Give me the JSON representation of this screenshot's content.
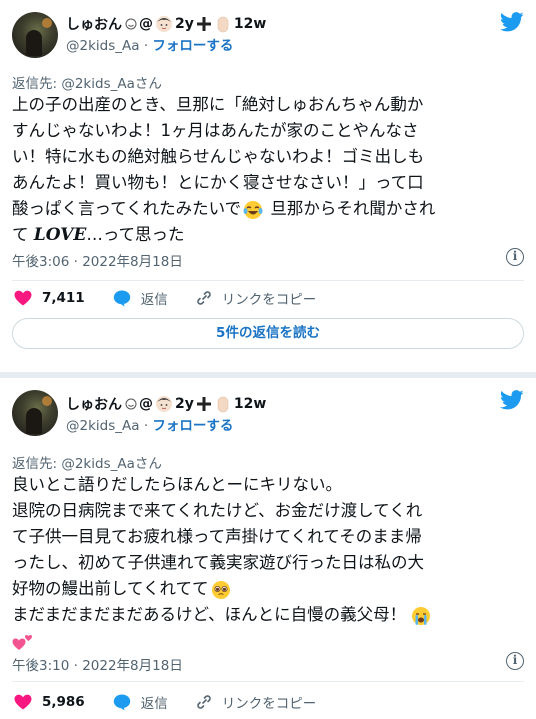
{
  "tweets": [
    {
      "display_name": "しゅおん",
      "name_suffix": "2y",
      "name_suffix2": "12w",
      "handle": "@2kids_Aa",
      "follow_label": "フォローする",
      "reply_to": "返信先: @2kids_Aaさん",
      "lines": [
        "上の子の出産のとき、旦那に「絶対しゅおんちゃん動か",
        "すんじゃないわよ！1ヶ月はあんたが家のことやんなさ",
        "い！特に水もの絶対触らせんじゃないわよ！ゴミ出しも",
        "あんたよ！買い物も！とにかく寝させなさい！」って口",
        "酸っぱく言ってくれたみたいで",
        " 旦那からそれ聞かされ",
        "て ",
        "LOVE",
        "…って思った"
      ],
      "timestamp": "午後3:06 · 2022年8月18日",
      "likes": "7,411",
      "reply_label": "返信",
      "copy_link_label": "リンクをコピー",
      "read_replies_label": "5件の返信を読む"
    },
    {
      "display_name": "しゅおん",
      "name_suffix": "2y",
      "name_suffix2": "12w",
      "handle": "@2kids_Aa",
      "follow_label": "フォローする",
      "reply_to": "返信先: @2kids_Aaさん",
      "lines": [
        "良いとこ語りだしたらほんとーにキリない。",
        "退院の日病院まで来てくれたけど、お金だけ渡してくれ",
        "て子供一目見てお疲れ様って声掛けてくれてそのまま帰",
        "ったし、初めて子供連れて義実家遊び行った日は私の大",
        "好物の鰻出前してくれてて",
        "まだまだまだまだあるけど、ほんとに自慢の義父母！"
      ],
      "timestamp": "午後3:10 · 2022年8月18日",
      "likes": "5,986",
      "reply_label": "返信",
      "copy_link_label": "リンクをコピー"
    }
  ],
  "colors": {
    "twitter_blue": "#1d9bf0",
    "like_pink": "#f91880",
    "link_blue": "#1b74c5",
    "muted": "#536471"
  },
  "icons": [
    "twitter-bird-icon",
    "heart-icon",
    "reply-bubble-icon",
    "link-icon",
    "info-icon",
    "baby-emoji",
    "cross-emoji",
    "hand-emoji",
    "smiley-emoji",
    "crying-laugh-emoji",
    "pleading-emoji",
    "loudly-crying-emoji",
    "two-hearts-emoji"
  ]
}
